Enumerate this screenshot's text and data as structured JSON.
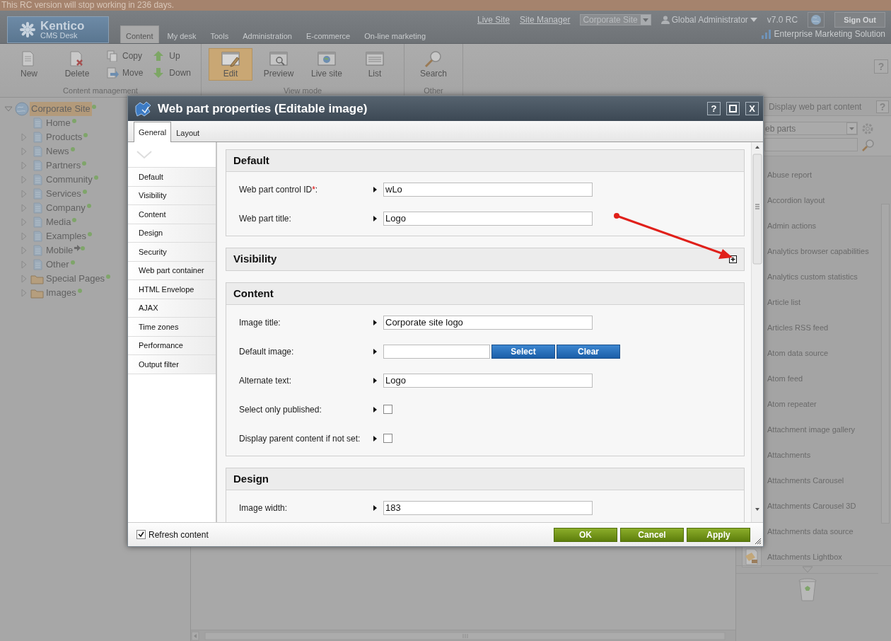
{
  "banner": {
    "text": "This RC version will stop working in 236 days."
  },
  "header": {
    "logo": {
      "name": "Kentico",
      "subtitle": "CMS Desk"
    },
    "tabs": [
      {
        "label": "Content",
        "selected": true
      },
      {
        "label": "My desk",
        "selected": false
      },
      {
        "label": "Tools",
        "selected": false
      },
      {
        "label": "Administration",
        "selected": false
      },
      {
        "label": "E-commerce",
        "selected": false
      },
      {
        "label": "On-line marketing",
        "selected": false
      }
    ],
    "links": [
      "Live Site",
      "Site Manager"
    ],
    "site_select": {
      "value": "Corporate Site"
    },
    "user": "Global Administrator",
    "version": "v7.0 RC",
    "sign_out": "Sign Out",
    "edition": "Enterprise Marketing Solution"
  },
  "toolbar": {
    "help": "?",
    "groups": [
      {
        "label": "Content management",
        "buttons": [
          {
            "label": "New",
            "kind": "large",
            "selected": false
          },
          {
            "label": "Delete",
            "kind": "large",
            "selected": false
          },
          {
            "label": "Copy",
            "kind": "small",
            "selected": false
          },
          {
            "label": "Move",
            "kind": "small",
            "selected": false
          },
          {
            "label": "Up",
            "kind": "small",
            "selected": false
          },
          {
            "label": "Down",
            "kind": "small",
            "selected": false
          }
        ]
      },
      {
        "label": "View mode",
        "buttons": [
          {
            "label": "Edit",
            "kind": "large",
            "selected": true
          },
          {
            "label": "Preview",
            "kind": "large",
            "selected": false
          },
          {
            "label": "Live site",
            "kind": "large",
            "selected": false
          },
          {
            "label": "List",
            "kind": "large",
            "selected": false
          }
        ]
      },
      {
        "label": "Other",
        "buttons": [
          {
            "label": "Search",
            "kind": "large",
            "selected": false
          }
        ]
      }
    ]
  },
  "tree": {
    "label": "Corporate Site",
    "expanded": true,
    "selected": true,
    "children": [
      {
        "label": "Home",
        "kind": "page",
        "has_children": false,
        "linked": false
      },
      {
        "label": "Products",
        "kind": "page",
        "has_children": true,
        "linked": false
      },
      {
        "label": "News",
        "kind": "page",
        "has_children": true,
        "linked": false
      },
      {
        "label": "Partners",
        "kind": "page",
        "has_children": true,
        "linked": false
      },
      {
        "label": "Community",
        "kind": "page",
        "has_children": true,
        "linked": false
      },
      {
        "label": "Services",
        "kind": "page",
        "has_children": true,
        "linked": false
      },
      {
        "label": "Company",
        "kind": "page",
        "has_children": true,
        "linked": false
      },
      {
        "label": "Media",
        "kind": "page",
        "has_children": true,
        "linked": false
      },
      {
        "label": "Examples",
        "kind": "page",
        "has_children": true,
        "linked": false
      },
      {
        "label": "Mobile",
        "kind": "page",
        "has_children": true,
        "linked": true
      },
      {
        "label": "Other",
        "kind": "page",
        "has_children": true,
        "linked": false
      },
      {
        "label": "Special Pages",
        "kind": "folder",
        "has_children": true,
        "linked": false
      },
      {
        "label": "Images",
        "kind": "folder",
        "has_children": true,
        "linked": false
      }
    ]
  },
  "web_parts_panel": {
    "display_content": {
      "label": "Display web part content"
    },
    "help": "?",
    "category_select": {
      "value": "eb parts"
    },
    "items": [
      {
        "label": "Abuse report",
        "thumbnail": false
      },
      {
        "label": "Accordion layout",
        "thumbnail": false
      },
      {
        "label": "Admin actions",
        "thumbnail": false
      },
      {
        "label": "Analytics browser capabilities",
        "thumbnail": false
      },
      {
        "label": "Analytics custom statistics",
        "thumbnail": false
      },
      {
        "label": "Article list",
        "thumbnail": false
      },
      {
        "label": "Articles RSS feed",
        "thumbnail": false
      },
      {
        "label": "Atom data source",
        "thumbnail": false
      },
      {
        "label": "Atom feed",
        "thumbnail": false
      },
      {
        "label": "Atom repeater",
        "thumbnail": false
      },
      {
        "label": "Attachment image gallery",
        "thumbnail": false
      },
      {
        "label": "Attachments",
        "thumbnail": false
      },
      {
        "label": "Attachments Carousel",
        "thumbnail": false
      },
      {
        "label": "Attachments Carousel 3D",
        "thumbnail": false
      },
      {
        "label": "Attachments data source",
        "thumbnail": false
      },
      {
        "label": "Attachments Lightbox",
        "thumbnail": true
      }
    ]
  },
  "dialog": {
    "title": "Web part properties (Editable image)",
    "help": "?",
    "close": "X",
    "tabs": [
      {
        "label": "General",
        "selected": true
      },
      {
        "label": "Layout",
        "selected": false
      }
    ],
    "categories": [
      "Default",
      "Visibility",
      "Content",
      "Design",
      "Security",
      "Web part container",
      "HTML Envelope",
      "AJAX",
      "Time zones",
      "Performance",
      "Output filter"
    ],
    "sections": [
      {
        "title": "Default",
        "expanded": true,
        "fields": [
          {
            "kind": "text",
            "label": "Web part control ID",
            "required_mark": "*",
            "label_end": ":",
            "value": "wLo"
          },
          {
            "kind": "text",
            "label": "Web part title:",
            "value": "Logo"
          }
        ]
      },
      {
        "title": "Visibility",
        "expanded": false
      },
      {
        "title": "Content",
        "expanded": true,
        "fields": [
          {
            "kind": "text",
            "label": "Image title:",
            "value": "Corporate site logo"
          },
          {
            "kind": "image",
            "label": "Default image:",
            "buttons": [
              "Select",
              "Clear"
            ]
          },
          {
            "kind": "text",
            "label": "Alternate text:",
            "value": "Logo"
          },
          {
            "kind": "checkbox",
            "label": "Select only published:",
            "checked": false
          },
          {
            "kind": "checkbox",
            "label": "Display parent content if not set:",
            "checked": false
          }
        ]
      },
      {
        "title": "Design",
        "expanded": true,
        "fields": [
          {
            "kind": "text",
            "label": "Image width:",
            "value": "183"
          }
        ]
      }
    ],
    "footer": {
      "refresh": {
        "label": "Refresh content",
        "checked": true
      },
      "buttons": [
        "OK",
        "Cancel",
        "Apply"
      ]
    }
  }
}
